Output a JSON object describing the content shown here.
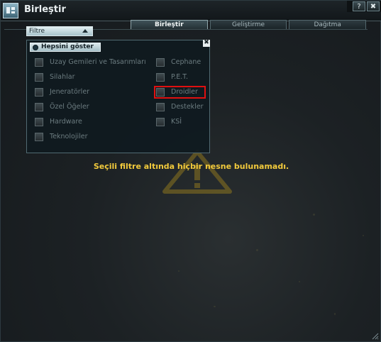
{
  "window": {
    "title": "Birleştir",
    "help_label": "?",
    "close_label": "✖"
  },
  "tabs": [
    {
      "label": "Birleştir",
      "active": true
    },
    {
      "label": "Geliştirme",
      "active": false
    },
    {
      "label": "Dağıtma",
      "active": false
    }
  ],
  "filter": {
    "label": "Filtre"
  },
  "filter_panel": {
    "close_label": "✖",
    "show_all_label": "Hepsini göster",
    "left_items": [
      {
        "label": "Uzay Gemileri ve Tasarımları"
      },
      {
        "label": "Silahlar"
      },
      {
        "label": "Jeneratörler"
      },
      {
        "label": "Özel Öğeler"
      },
      {
        "label": "Hardware"
      },
      {
        "label": "Teknolojiler"
      }
    ],
    "right_items": [
      {
        "label": "Cephane"
      },
      {
        "label": "P.E.T."
      },
      {
        "label": "Droidler",
        "highlighted": true
      },
      {
        "label": "Destekler"
      },
      {
        "label": "KSİ"
      }
    ]
  },
  "empty_message": "Seçili filtre altında hiçbir nesne bulunamadı.",
  "colors": {
    "message": "#f2ca3c",
    "highlight": "#e01010"
  }
}
